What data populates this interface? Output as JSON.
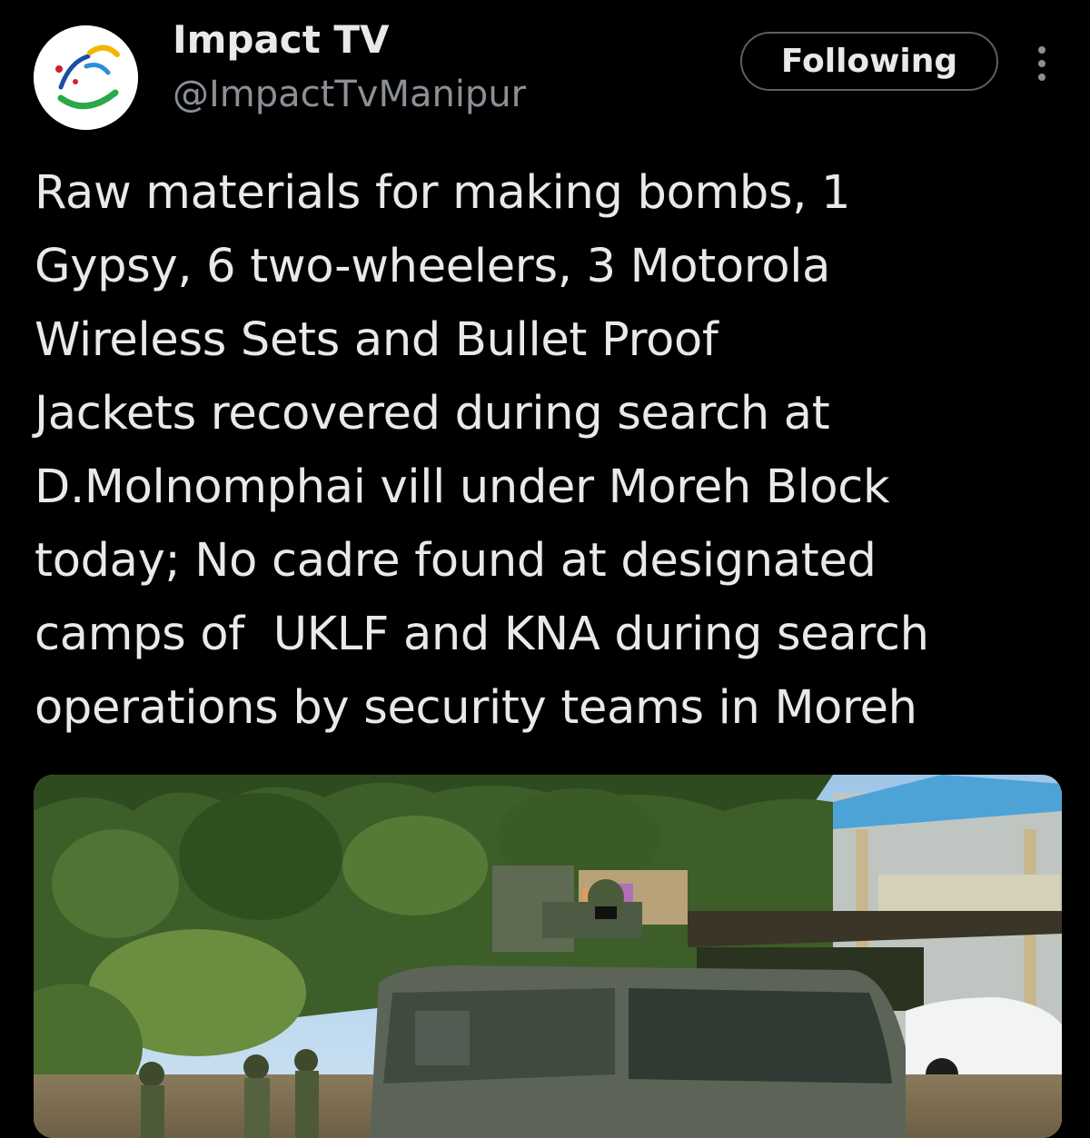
{
  "account": {
    "display_name": "Impact TV",
    "handle": "@ImpactTvManipur",
    "avatar_icon": "impact-tv-logo"
  },
  "actions": {
    "follow_label": "Following",
    "more_icon": "more-vertical-icon"
  },
  "tweet": {
    "lines": [
      "Raw materials for making bombs, 1",
      "Gypsy, 6 two-wheelers, 3 Motorola",
      "Wireless Sets and Bullet Proof",
      "Jackets recovered during search at",
      "D.Molnomphai vill under Moreh Block",
      "today; No cadre found at designated",
      "camps of  UKLF and KNA during search",
      "operations by security teams in Moreh"
    ]
  },
  "media": {
    "kind": "photo"
  },
  "colors": {
    "background": "#000000",
    "text_primary": "#e7e9ea",
    "text_secondary": "#8b9096",
    "button_border": "#596067"
  }
}
